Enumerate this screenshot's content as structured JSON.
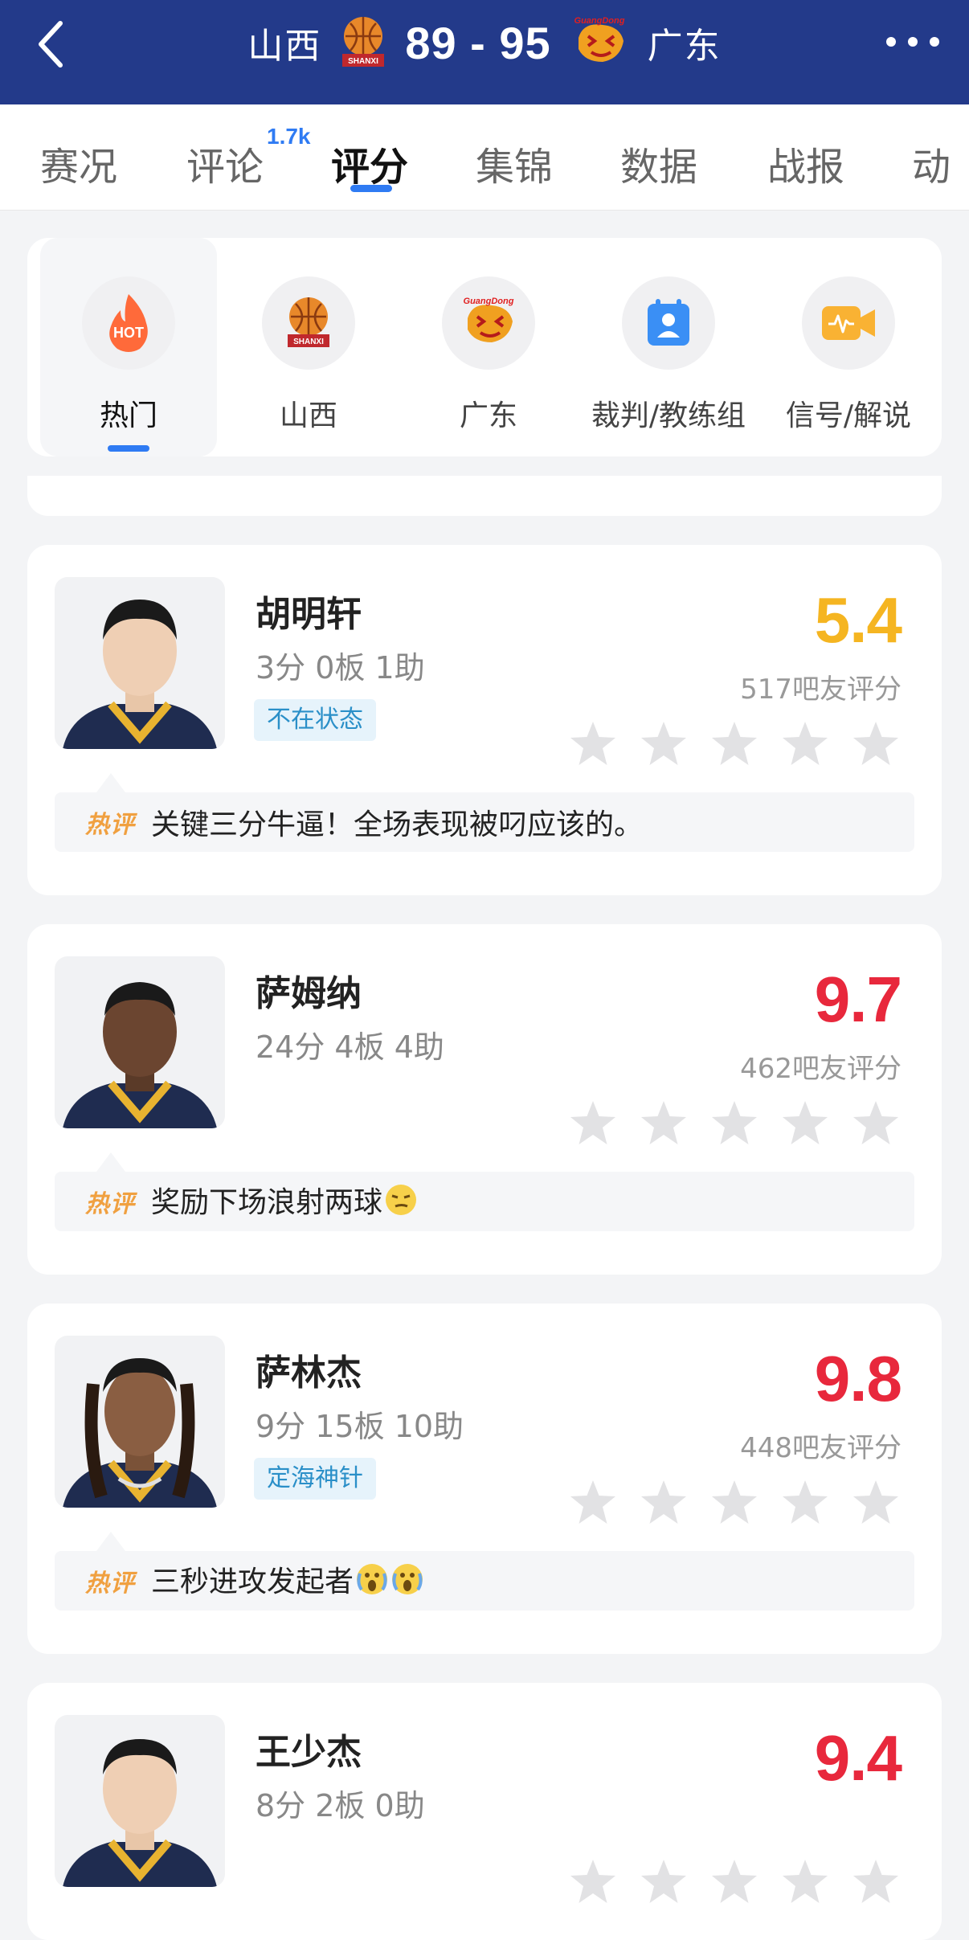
{
  "header": {
    "home_team": "山西",
    "score": "89 - 95",
    "away_team": "广东",
    "home_logo_text": "SHANXI",
    "away_logo_text": "GuangDong"
  },
  "tabs": [
    {
      "label": "赛况"
    },
    {
      "label": "评论",
      "badge": "1.7k"
    },
    {
      "label": "评分",
      "active": true
    },
    {
      "label": "集锦"
    },
    {
      "label": "数据"
    },
    {
      "label": "战报"
    },
    {
      "label": "动"
    }
  ],
  "categories": [
    {
      "label": "热门",
      "icon": "hot-icon",
      "icon_text": "HOT",
      "active": true
    },
    {
      "label": "山西",
      "icon": "shanxi-logo-icon"
    },
    {
      "label": "广东",
      "icon": "guangdong-logo-icon"
    },
    {
      "label": "裁判/教练组",
      "icon": "referee-badge-icon"
    },
    {
      "label": "信号/解说",
      "icon": "video-camera-icon"
    }
  ],
  "players": [
    {
      "name": "胡明轩",
      "stats": "3分 0板 1助",
      "tag": "不在状态",
      "rating": "5.4",
      "rating_color": "#f5b521",
      "count": "517吧友评分",
      "hot_label": "热评",
      "comment": "关键三分牛逼！全场表现被叼应该的。"
    },
    {
      "name": "萨姆纳",
      "stats": "24分 4板 4助",
      "tag": "",
      "rating": "9.7",
      "rating_color": "#e8283c",
      "count": "462吧友评分",
      "hot_label": "热评",
      "comment": "奖励下场浪射两球"
    },
    {
      "name": "萨林杰",
      "stats": "9分 15板 10助",
      "tag": "定海神针",
      "rating": "9.8",
      "rating_color": "#e8283c",
      "count": "448吧友评分",
      "hot_label": "热评",
      "comment": "三秒进攻发起者"
    },
    {
      "name": "王少杰",
      "stats": "8分 2板 0助",
      "tag": "",
      "rating": "9.4",
      "rating_color": "#e8283c",
      "count": "",
      "hot_label": "",
      "comment": ""
    }
  ],
  "colors": {
    "header_bg": "#233a8a",
    "accent": "#2f7bf3",
    "rating_low": "#f5b521",
    "rating_high": "#e8283c"
  }
}
